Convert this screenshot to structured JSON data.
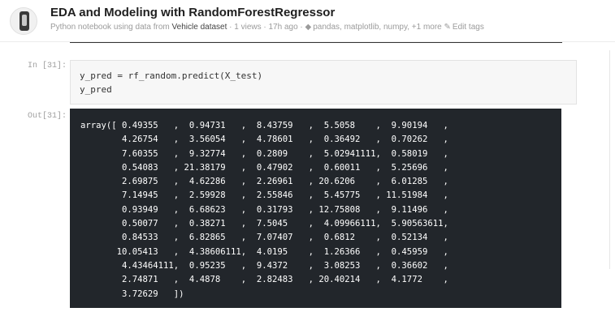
{
  "header": {
    "title": "EDA and Modeling with RandomForestRegressor",
    "subtitle_prefix": "Python notebook using data from ",
    "dataset": "Vehicle dataset",
    "meta": " · 1 views · 17h ago · ",
    "tags": "pandas, matplotlib, numpy, +1 more",
    "edit_tags": "Edit tags",
    "tag_icon": "tag-icon",
    "edit_icon": "pencil-icon"
  },
  "cells": {
    "input": {
      "prompt": "In [31]:",
      "lines": [
        "y_pred = rf_random.predict(X_test)",
        "y_pred"
      ]
    },
    "output": {
      "prompt": "Out[31]:",
      "lines": [
        "array([ 0.49355   ,  0.94731   ,  8.43759   ,  5.5058    ,  9.90194   ,",
        "        4.26754   ,  3.56054   ,  4.78601   ,  0.36492   ,  0.70262   ,",
        "        7.60355   ,  9.32774   ,  0.2809    ,  5.02941111,  0.58019   ,",
        "        0.54083   , 21.38179   ,  0.47902   ,  0.60011   ,  5.25696   ,",
        "        2.69875   ,  4.62286   ,  2.26961   , 20.6206    ,  6.01285   ,",
        "        7.14945   ,  2.59928   ,  2.55846   ,  5.45775   , 11.51984   ,",
        "        0.93949   ,  6.68623   ,  0.31793   , 12.75808   ,  9.11496   ,",
        "        0.50077   ,  0.38271   ,  7.5045    ,  4.09966111,  5.90563611,",
        "        0.84533   ,  6.82865   ,  7.07407   ,  0.6812    ,  0.52134   ,",
        "       10.05413   ,  4.38606111,  4.0195    ,  1.26366   ,  0.45959   ,",
        "        4.43464111,  0.95235   ,  9.4372    ,  3.08253   ,  0.36602   ,",
        "        2.74871   ,  4.4878    ,  2.82483   , 20.40214   ,  4.1772    ,",
        "        3.72629   ])"
      ]
    }
  }
}
